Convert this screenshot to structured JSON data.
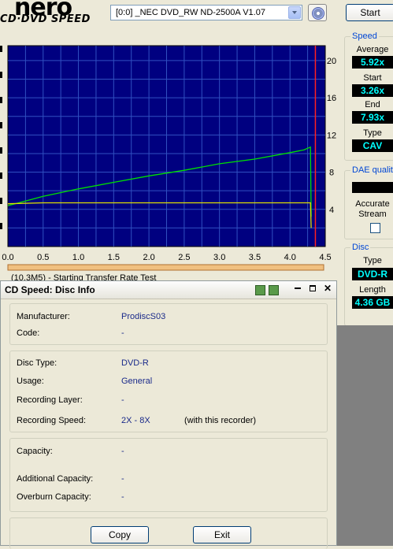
{
  "header": {
    "logo_top": "nero",
    "logo_bottom": "CD·DVD SPEED",
    "drive": "[0:0]  _NEC DVD_RW ND-2500A V1.07",
    "start_label": "Start"
  },
  "chart_data": {
    "type": "line",
    "x_ticks": [
      "0.0",
      "0.5",
      "1.0",
      "1.5",
      "2.0",
      "2.5",
      "3.0",
      "3.5",
      "4.0",
      "4.5"
    ],
    "y_right_ticks": [
      "20",
      "16",
      "12",
      "8",
      "4"
    ],
    "xlim": [
      0,
      4.5
    ],
    "ylim": [
      0,
      21.6
    ],
    "series": [
      {
        "color": "#00e000",
        "x": [
          0,
          0.5,
          1.0,
          1.5,
          2.0,
          2.5,
          3.0,
          3.5,
          4.0,
          4.2,
          4.29,
          4.3
        ],
        "y": [
          4.4,
          5.4,
          6.2,
          6.9,
          7.6,
          8.2,
          8.9,
          9.4,
          10.1,
          10.4,
          10.7,
          3.2
        ]
      },
      {
        "color": "#e0e000",
        "x": [
          0,
          0.5,
          1.0,
          1.5,
          2.0,
          2.5,
          3.0,
          3.5,
          4.0,
          4.29,
          4.3
        ],
        "y": [
          4.6,
          4.7,
          4.7,
          4.7,
          4.7,
          4.7,
          4.7,
          4.7,
          4.7,
          4.7,
          2.0
        ]
      }
    ],
    "marker_x": 4.36,
    "grid": true
  },
  "speed": {
    "title": "Speed",
    "average_label": "Average",
    "average": "5.92x",
    "start_label": "Start",
    "start": "3.26x",
    "end_label": "End",
    "end": "7.93x",
    "type_label": "Type",
    "type": "CAV"
  },
  "dae": {
    "title": "DAE quality",
    "accurate_label": "Accurate",
    "stream_label": "Stream"
  },
  "disc": {
    "title": "Disc",
    "type_label": "Type",
    "type": "DVD-R",
    "length_label": "Length",
    "length": "4.36 GB"
  },
  "status_line": "(10.3M5) - Starting Transfer Rate Test",
  "dialog": {
    "title": "CD Speed: Disc Info",
    "manufacturer_label": "Manufacturer:",
    "manufacturer": "ProdiscS03",
    "code_label": "Code:",
    "code": "-",
    "disc_type_label": "Disc Type:",
    "disc_type": "DVD-R",
    "usage_label": "Usage:",
    "usage": "General",
    "layer_label": "Recording Layer:",
    "layer": "-",
    "rec_speed_label": "Recording Speed:",
    "rec_speed": "2X - 8X",
    "rec_speed_note": "(with this recorder)",
    "capacity_label": "Capacity:",
    "capacity": "-",
    "add_capacity_label": "Additional Capacity:",
    "add_capacity": "-",
    "overburn_label": "Overburn Capacity:",
    "overburn": "-",
    "copy_label": "Copy",
    "exit_label": "Exit"
  }
}
